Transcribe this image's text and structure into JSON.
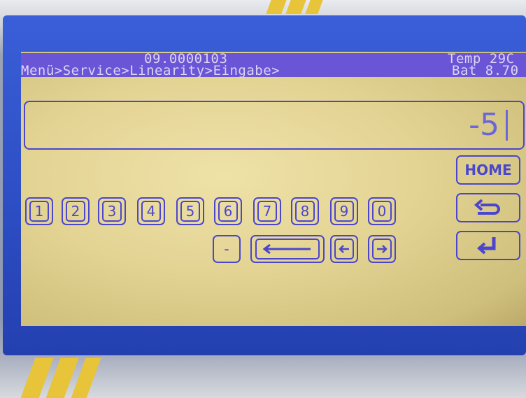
{
  "header": {
    "device_id": "09.0000103",
    "temperature": "Temp 29C",
    "breadcrumb": "Menü>Service>Linearity>Eingabe>",
    "battery": "Bat 8.70"
  },
  "input": {
    "value": "-5"
  },
  "keypad": {
    "digits": [
      "1",
      "2",
      "3",
      "4",
      "5",
      "6",
      "7",
      "8",
      "9",
      "0"
    ],
    "minus_label": "-"
  },
  "buttons": {
    "home_label": "HOME"
  },
  "icons": {
    "backspace": "long-left-arrow-icon",
    "cursor_left": "left-arrow-icon",
    "cursor_right": "right-arrow-icon",
    "back": "return-arrow-icon",
    "enter": "enter-icon"
  },
  "colors": {
    "lcd_background": "#e6d79a",
    "lcd_foreground": "#4b46cc",
    "header_bar": "#6a55d6",
    "bezel": "#2f50c8"
  }
}
